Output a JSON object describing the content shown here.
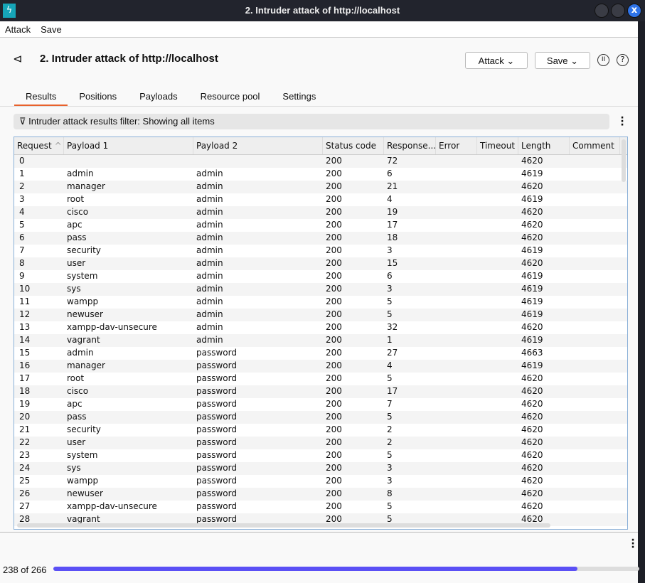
{
  "window": {
    "title": "2. Intruder attack of http://localhost",
    "close_glyph": "x"
  },
  "menu": [
    "Attack",
    "Save"
  ],
  "header": {
    "title": "2. Intruder attack of http://localhost",
    "attack_btn": "Attack",
    "save_btn": "Save"
  },
  "tabs": [
    "Results",
    "Positions",
    "Payloads",
    "Resource pool",
    "Settings"
  ],
  "filter": "Intruder attack results filter: Showing all items",
  "columns": [
    "Request",
    "Payload 1",
    "Payload 2",
    "Status code",
    "Response...",
    "Error",
    "Timeout",
    "Length",
    "Comment"
  ],
  "rows": [
    [
      "0",
      "",
      "",
      "200",
      "72",
      "",
      "",
      "4620",
      ""
    ],
    [
      "1",
      "admin",
      "admin",
      "200",
      "6",
      "",
      "",
      "4619",
      ""
    ],
    [
      "2",
      "manager",
      "admin",
      "200",
      "21",
      "",
      "",
      "4620",
      ""
    ],
    [
      "3",
      "root",
      "admin",
      "200",
      "4",
      "",
      "",
      "4619",
      ""
    ],
    [
      "4",
      "cisco",
      "admin",
      "200",
      "19",
      "",
      "",
      "4620",
      ""
    ],
    [
      "5",
      "apc",
      "admin",
      "200",
      "17",
      "",
      "",
      "4620",
      ""
    ],
    [
      "6",
      "pass",
      "admin",
      "200",
      "18",
      "",
      "",
      "4620",
      ""
    ],
    [
      "7",
      "security",
      "admin",
      "200",
      "3",
      "",
      "",
      "4619",
      ""
    ],
    [
      "8",
      "user",
      "admin",
      "200",
      "15",
      "",
      "",
      "4620",
      ""
    ],
    [
      "9",
      "system",
      "admin",
      "200",
      "6",
      "",
      "",
      "4619",
      ""
    ],
    [
      "10",
      "sys",
      "admin",
      "200",
      "3",
      "",
      "",
      "4619",
      ""
    ],
    [
      "11",
      "wampp",
      "admin",
      "200",
      "5",
      "",
      "",
      "4619",
      ""
    ],
    [
      "12",
      "newuser",
      "admin",
      "200",
      "5",
      "",
      "",
      "4619",
      ""
    ],
    [
      "13",
      "xampp-dav-unsecure",
      "admin",
      "200",
      "32",
      "",
      "",
      "4620",
      ""
    ],
    [
      "14",
      "vagrant",
      "admin",
      "200",
      "1",
      "",
      "",
      "4619",
      ""
    ],
    [
      "15",
      "admin",
      "password",
      "200",
      "27",
      "",
      "",
      "4663",
      ""
    ],
    [
      "16",
      "manager",
      "password",
      "200",
      "4",
      "",
      "",
      "4619",
      ""
    ],
    [
      "17",
      "root",
      "password",
      "200",
      "5",
      "",
      "",
      "4620",
      ""
    ],
    [
      "18",
      "cisco",
      "password",
      "200",
      "17",
      "",
      "",
      "4620",
      ""
    ],
    [
      "19",
      "apc",
      "password",
      "200",
      "7",
      "",
      "",
      "4620",
      ""
    ],
    [
      "20",
      "pass",
      "password",
      "200",
      "5",
      "",
      "",
      "4620",
      ""
    ],
    [
      "21",
      "security",
      "password",
      "200",
      "2",
      "",
      "",
      "4620",
      ""
    ],
    [
      "22",
      "user",
      "password",
      "200",
      "2",
      "",
      "",
      "4620",
      ""
    ],
    [
      "23",
      "system",
      "password",
      "200",
      "5",
      "",
      "",
      "4620",
      ""
    ],
    [
      "24",
      "sys",
      "password",
      "200",
      "3",
      "",
      "",
      "4620",
      ""
    ],
    [
      "25",
      "wampp",
      "password",
      "200",
      "3",
      "",
      "",
      "4620",
      ""
    ],
    [
      "26",
      "newuser",
      "password",
      "200",
      "8",
      "",
      "",
      "4620",
      ""
    ],
    [
      "27",
      "xampp-dav-unsecure",
      "password",
      "200",
      "5",
      "",
      "",
      "4620",
      ""
    ],
    [
      "28",
      "vagrant",
      "password",
      "200",
      "5",
      "",
      "",
      "4620",
      ""
    ]
  ],
  "progress": {
    "label": "238 of 266",
    "done": 238,
    "total": 266,
    "color": "#5b50f5"
  }
}
